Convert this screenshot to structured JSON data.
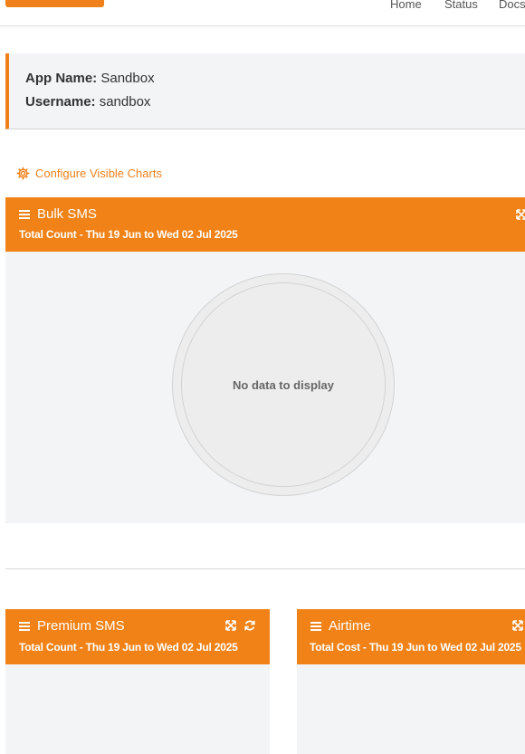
{
  "nav": {
    "home": "Home",
    "status": "Status",
    "docs": "Docs"
  },
  "info": {
    "app_name_label": "App Name:",
    "app_name": "Sandbox",
    "username_label": "Username:",
    "username": "sandbox"
  },
  "configure_label": "Configure Visible Charts",
  "cards": {
    "bulk": {
      "title": "Bulk SMS",
      "subtitle": "Total Count - Thu 19 Jun to Wed 02 Jul 2025",
      "empty_text": "No data to display"
    },
    "premium": {
      "title": "Premium SMS",
      "subtitle": "Total Count - Thu 19 Jun to Wed 02 Jul 2025"
    },
    "airtime": {
      "title": "Airtime",
      "subtitle": "Total Cost - Thu 19 Jun to Wed 02 Jul 2025"
    }
  },
  "colors": {
    "accent": "#f08217",
    "panel": "#f3f4f6"
  }
}
